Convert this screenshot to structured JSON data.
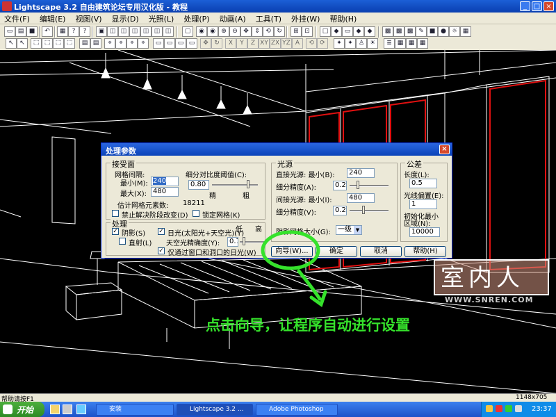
{
  "window": {
    "title": "Lightscape 3.2 自由建筑论坛专用汉化版  - 教程",
    "min": "_",
    "max": "□",
    "close": "×"
  },
  "menu": [
    "文件(F)",
    "编辑(E)",
    "视图(V)",
    "显示(D)",
    "光照(L)",
    "处理(P)",
    "动画(A)",
    "工具(T)",
    "外挂(W)",
    "帮助(H)"
  ],
  "toolbar2": {
    "axis": [
      "X",
      "Y",
      "Z",
      "XY",
      "ZX",
      "YZ",
      "A"
    ]
  },
  "dialog": {
    "title": "处理参数",
    "close": "×",
    "receiving": {
      "group": "接受面",
      "mesh_spacing": "网格间隔:",
      "min_label": "最小(M):",
      "min_value": "240",
      "max_label": "最大(X):",
      "max_value": "480",
      "subdiv_label": "细分对比度阈值(C):",
      "subdiv_value": "0.80",
      "fine": "精",
      "coarse": "粗",
      "estimate_label": "估计网格元素数:",
      "estimate_value": "18211",
      "disable_decomposition": "禁止解决阶段改变(D)",
      "lock_mesh": "锁定网格(K)"
    },
    "processing": {
      "group": "处理",
      "shadow": "阴影(S)",
      "shadow_checked": "✓",
      "daylight": "日光(太阳光+天空光)(Y)",
      "daylight_checked": "✓",
      "direct_only": "直射(L)",
      "sky_precision": "天空光精确度(Y):",
      "sky_value": "0.7",
      "low": "低",
      "high": "高",
      "through_windows": "仅通过窗口和洞口的日光(W)",
      "through_checked": "✓"
    },
    "source": {
      "group": "光源",
      "direct_min_label": "直接光源:  最小(B):",
      "direct_min_value": "240",
      "direct_fine_label": "细分精度(A):",
      "direct_fine_value": "0.25",
      "indirect_min_label": "间接光源:  最小(I):",
      "indirect_min_value": "480",
      "indirect_fine_label": "细分精度(V):",
      "indirect_fine_value": "0.20",
      "shadow_grid_label": "阴影网格大小(G):",
      "shadow_grid_value": "一级"
    },
    "tolerance": {
      "group": "公差",
      "length_label": "长度(L):",
      "length_value": "0.5",
      "offset_label": "光线偏置(E):",
      "offset_value": "1",
      "init_label_1": "初始化最小",
      "init_label_2": "区域(N):",
      "init_value": "10000"
    },
    "buttons": {
      "wizard": "向导(W)...",
      "ok": "确定",
      "cancel": "取消",
      "help": "帮助(H)"
    }
  },
  "annotation": {
    "text": "点击向导，让程序自动进行设置",
    "color": "#35e22b"
  },
  "watermark": {
    "title": "室内人",
    "url": "WWW.SNREN.COM"
  },
  "status": {
    "help": "帮助请按F1",
    "size": "1148x705"
  },
  "taskbar": {
    "start": "开始",
    "tasks": [
      "安装",
      "Lightscape 3.2 ...",
      "Adobe Photoshop"
    ],
    "clock": "23:37"
  }
}
